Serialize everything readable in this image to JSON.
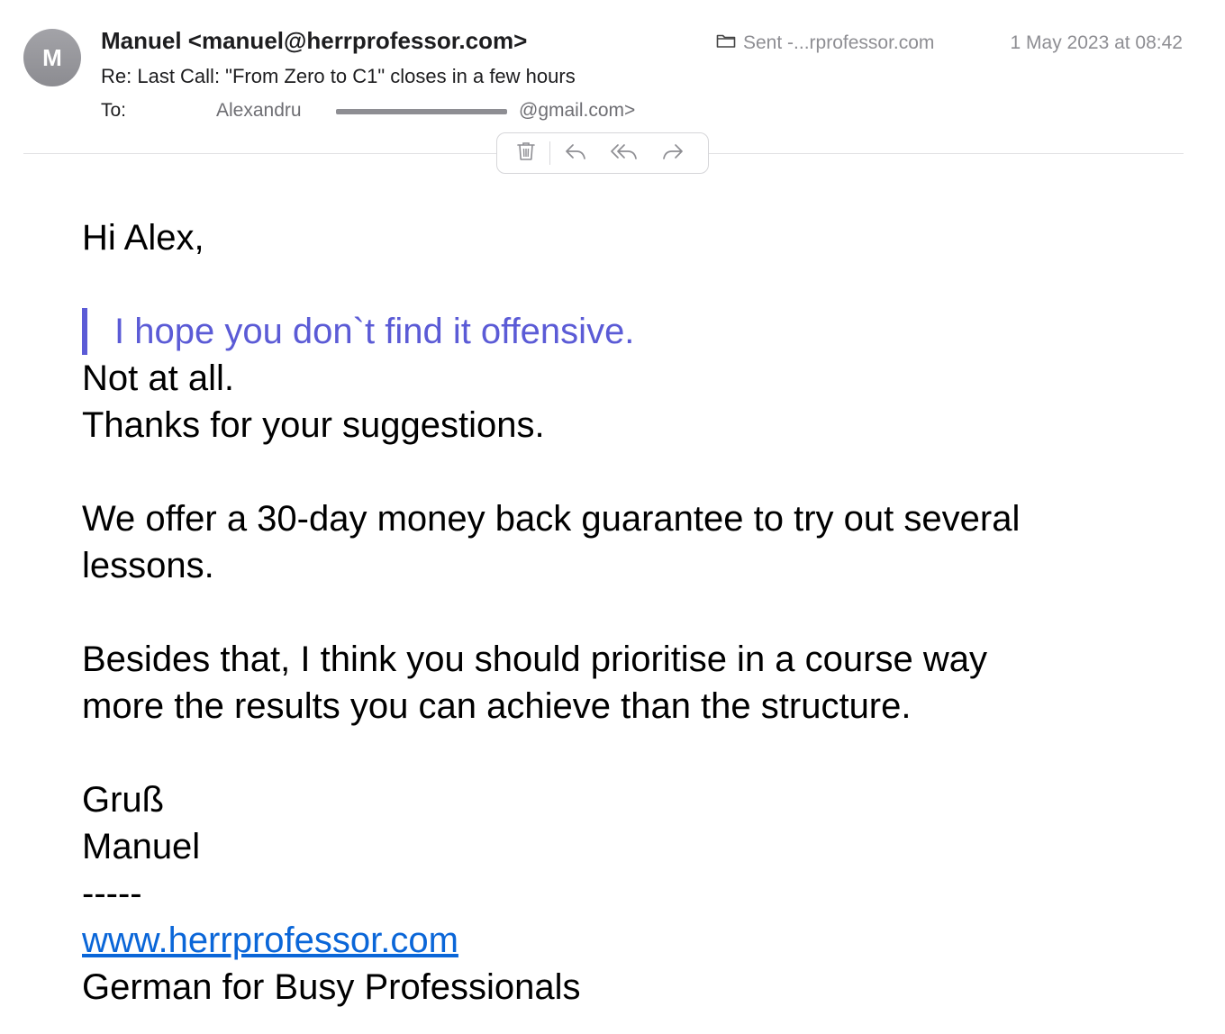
{
  "header": {
    "avatar_initial": "M",
    "sender": "Manuel <manuel@herrprofessor.com>",
    "subject": "Re: Last Call: \"From Zero to C1\" closes in a few hours",
    "to_label": "To:",
    "to_name": "Alexandru",
    "to_domain": "@gmail.com>",
    "mailbox": "Sent -...rprofessor.com",
    "date": "1 May 2023 at 08:42"
  },
  "toolbar": {
    "icons": [
      "trash-icon",
      "reply-icon",
      "reply-all-icon",
      "forward-icon"
    ]
  },
  "body": {
    "greeting": "Hi Alex,",
    "quote": "I hope you don`t find it offensive.",
    "line1": "Not at all.",
    "line2": "Thanks for your suggestions.",
    "para2_line1": "We offer a 30-day money back guarantee to try out several",
    "para2_line2": "lessons.",
    "para3_line1": "Besides that, I think you should prioritise in a course way",
    "para3_line2": "more the results you can achieve than the structure.",
    "sign1": "Gruß",
    "sign2": "Manuel",
    "separator": "-----",
    "link": "www.herrprofessor.com",
    "tagline": "German for Busy Professionals"
  },
  "colors": {
    "quote": "#5b5bd6",
    "link": "#0a66d8",
    "secondary_text": "#8e8e93"
  }
}
